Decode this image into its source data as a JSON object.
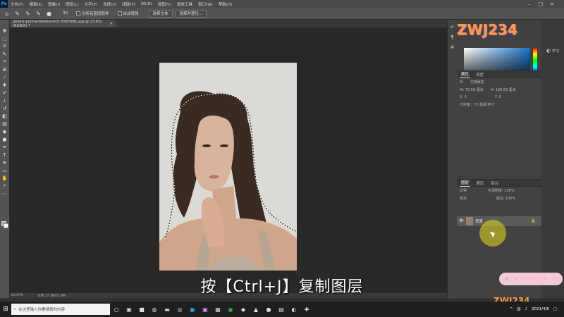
{
  "app": {
    "logo": "Ps"
  },
  "menu": [
    "文件(F)",
    "编辑(E)",
    "图像(I)",
    "图层(L)",
    "文字(Y)",
    "选择(S)",
    "滤镜(T)",
    "3D(D)",
    "视图(V)",
    "增效工具",
    "窗口(W)",
    "帮助(H)"
  ],
  "options": {
    "brush_size": "30",
    "sample_all": "对所有图层取样",
    "auto_enhance": "自动增强",
    "select_subject": "选择主体",
    "select_mask": "选择并遮住..."
  },
  "document": {
    "tab_title": "pexels-polina-tankilevitch-5587981.jpg @ 23.6%(RGB/8) *",
    "zoom": "23.57%",
    "doc_size": "文档:17.3M/22.9M"
  },
  "panels": {
    "properties_tab": "属性",
    "adjust_tab": "调整",
    "doc_props": "文档属性",
    "w_label": "W:",
    "w_value": "70.56 厘米",
    "h_label": "H:",
    "h_value": "105.83 厘米",
    "x_label": "X:",
    "x_value": "0",
    "y_label": "Y:",
    "y_value": "0",
    "resolution": "分辨率：72 像素/英寸",
    "layers_tab": "图层",
    "channels_tab": "通道",
    "paths_tab": "路径",
    "mode": "正常",
    "opacity": "不透明度: 100%",
    "lock": "锁定:",
    "fill": "填充: 100%",
    "layer_name": "背景",
    "learn": "学习"
  },
  "caption": "按【Ctrl+J】复制图层",
  "watermark": "ZWJ234",
  "taskbar": {
    "search_placeholder": "在这里输入你要搜索的内容",
    "time": "",
    "date": "2021/4/8"
  },
  "colors": {
    "accent": "#31a8ff",
    "fg_swatch": "#7fb8e0",
    "cursor_highlight": "#e6dc1e"
  }
}
